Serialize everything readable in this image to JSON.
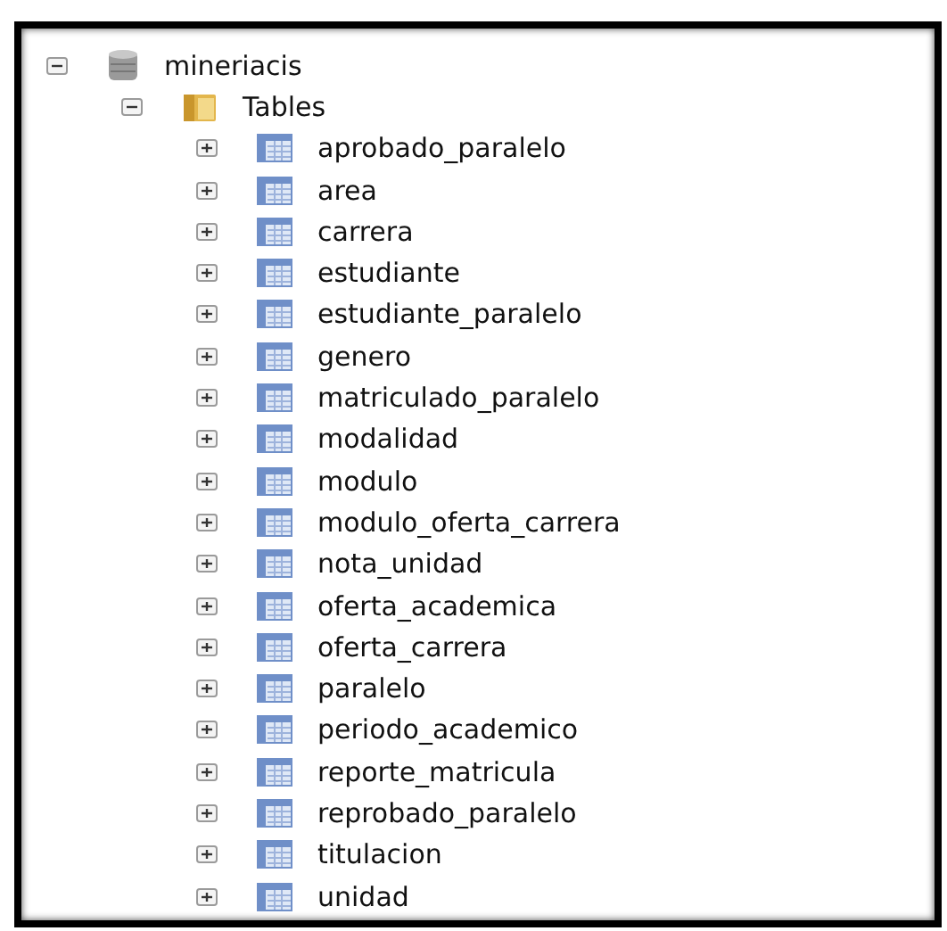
{
  "tree": [
    {
      "label": "mineriacis",
      "kind": "database",
      "expanded": true,
      "children": [
        {
          "label": "Tables",
          "kind": "folder",
          "expanded": true,
          "children": [
            {
              "label": "aprobado_paralelo",
              "kind": "table",
              "expanded": false
            },
            {
              "label": "area",
              "kind": "table",
              "expanded": false
            },
            {
              "label": "carrera",
              "kind": "table",
              "expanded": false
            },
            {
              "label": "estudiante",
              "kind": "table",
              "expanded": false
            },
            {
              "label": "estudiante_paralelo",
              "kind": "table",
              "expanded": false
            },
            {
              "label": "genero",
              "kind": "table",
              "expanded": false
            },
            {
              "label": "matriculado_paralelo",
              "kind": "table",
              "expanded": false
            },
            {
              "label": "modalidad",
              "kind": "table",
              "expanded": false
            },
            {
              "label": "modulo",
              "kind": "table",
              "expanded": false
            },
            {
              "label": "modulo_oferta_carrera",
              "kind": "table",
              "expanded": false
            },
            {
              "label": "nota_unidad",
              "kind": "table",
              "expanded": false
            },
            {
              "label": "oferta_academica",
              "kind": "table",
              "expanded": false
            },
            {
              "label": "oferta_carrera",
              "kind": "table",
              "expanded": false
            },
            {
              "label": "paralelo",
              "kind": "table",
              "expanded": false
            },
            {
              "label": "periodo_academico",
              "kind": "table",
              "expanded": false
            },
            {
              "label": "reporte_matricula",
              "kind": "table",
              "expanded": false
            },
            {
              "label": "reprobado_paralelo",
              "kind": "table",
              "expanded": false
            },
            {
              "label": "titulacion",
              "kind": "table",
              "expanded": false
            },
            {
              "label": "unidad",
              "kind": "table",
              "expanded": false
            }
          ]
        }
      ]
    }
  ]
}
